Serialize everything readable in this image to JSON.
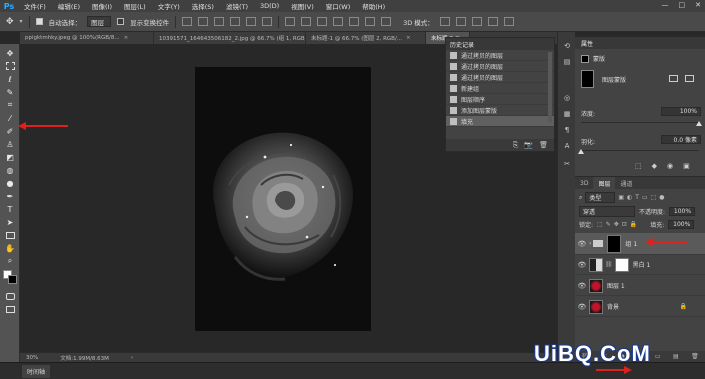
{
  "menubar": {
    "logo": "Ps",
    "items": [
      "文件(F)",
      "编辑(E)",
      "图像(I)",
      "图层(L)",
      "文字(Y)",
      "选择(S)",
      "滤镜(T)",
      "3D(D)",
      "视图(V)",
      "窗口(W)",
      "帮助(H)"
    ],
    "controls": [
      "—",
      "□",
      "✕"
    ]
  },
  "options": {
    "auto_select_label": "自动选择：",
    "auto_select_value": "图层",
    "show_transform_label": "显示变换控件",
    "mode_3d_label": "3D 模式："
  },
  "tabs": [
    {
      "label": "ppigktmhky.jpeg @ 100%(RGB/8...",
      "close": "×"
    },
    {
      "label": "10391571_164643506182_2.jpg @ 66.7% (组 1, RGB/8...",
      "close": "×"
    },
    {
      "label": "未标题-1 @ 66.7% (图层 2, RGB/...",
      "close": "×"
    },
    {
      "label": "未标题-2 @...",
      "close": "×"
    }
  ],
  "status": {
    "zoom": "30%",
    "doc": "文档:1.99M/8.63M",
    "arrow": "›"
  },
  "timeline": {
    "label": "时间轴"
  },
  "history": {
    "title": "历史记录",
    "items": [
      "通过拷贝的图层",
      "通过拷贝的图层",
      "通过拷贝的图层",
      "新建组",
      "图层顺序",
      "添加图层蒙版",
      "填充"
    ],
    "footer_icons": [
      "⎘",
      "📷",
      "🗑"
    ]
  },
  "properties": {
    "title": "属性",
    "mask_label": "蒙版",
    "layer_mask_label": "图层蒙版",
    "density_label": "浓度:",
    "density_value": "100%",
    "feather_label": "羽化:",
    "feather_value": "0.0 像素",
    "density_fraction": 1.0,
    "feather_fraction": 0.0
  },
  "layers": {
    "tabs": [
      "3D",
      "图层",
      "通道"
    ],
    "filter_label": "类型",
    "blend_mode": "穿透",
    "opacity_label": "不透明度:",
    "opacity_value": "100%",
    "lock_label": "锁定:",
    "fill_label": "填充:",
    "fill_value": "100%",
    "rows": [
      {
        "name": "组 1",
        "eye": "👁",
        "type": "group"
      },
      {
        "name": "黑白 1",
        "eye": "👁",
        "type": "adjust"
      },
      {
        "name": "图层 1",
        "eye": "👁",
        "type": "image"
      },
      {
        "name": "背景",
        "eye": "👁",
        "type": "background"
      }
    ],
    "footer_icons": [
      "⛓",
      "fx",
      "◑",
      "◐",
      "▭",
      "▤",
      "🗑"
    ]
  },
  "watermark": "UiBQ.CoM",
  "colors": {
    "accent": "#31a8ff",
    "arrow": "#e0201c"
  }
}
